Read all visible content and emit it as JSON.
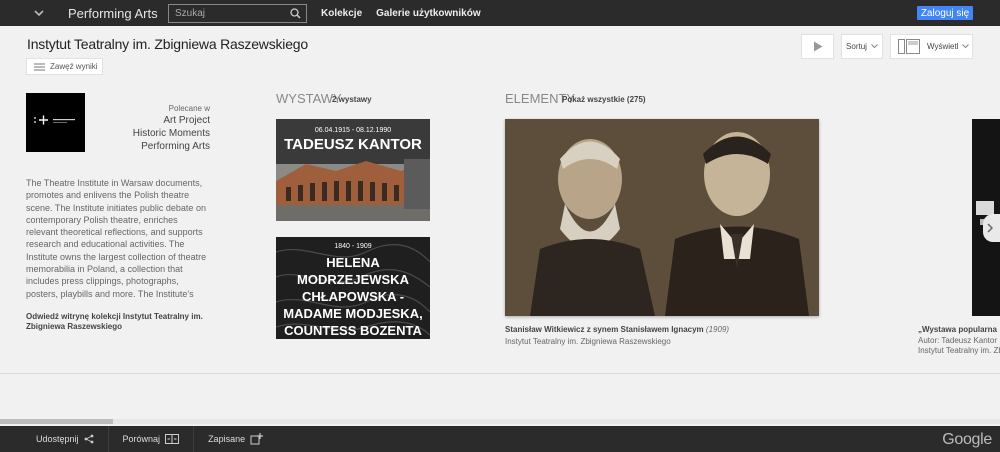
{
  "topbar": {
    "menu_icon": "chevron-down-icon",
    "brand": "Performing Arts",
    "search_placeholder": "Szukaj",
    "nav": [
      "Kolekcje",
      "Galerie użytkowników"
    ],
    "login_label": "Zaloguj się"
  },
  "header": {
    "title": "Instytut Teatralny im. Zbigniewa Raszewskiego",
    "refine_label": "Zawęź wyniki",
    "sort_label": "Sortuj",
    "view_label": "Wyświetl"
  },
  "sidebar": {
    "recommended_label": "Polecane w",
    "recommended_items": [
      "Art Project",
      "Historic Moments",
      "Performing Arts"
    ],
    "description": "The Theatre Institute in Warsaw documents, promotes and enlivens the Polish theatre scene. The Institute initiates public debate on contemporary Polish theatre, enriches relevant theoretical reflections, and supports research and educational activities. The Institute owns the largest collection of theatre memorabilia in Poland, a collection that includes press clippings, photographs, posters, playbills and more. The Institute's",
    "visit_link": "Odwiedź witrynę kolekcji Instytut Teatralny im. Zbigniewa Raszewskiego"
  },
  "exhibitions": {
    "heading": "WYSTAWY",
    "count": "2 wystawy",
    "items": [
      {
        "dates": "06.04.1915 - 08.12.1990",
        "title": "TADEUSZ KANTOR"
      },
      {
        "dates": "1840 - 1909",
        "title_lines": [
          "HELENA",
          "MODRZEJEWSKA",
          "CHŁAPOWSKA -",
          "MADAME MODJESKA,",
          "COUNTESS BOZENTA"
        ]
      }
    ]
  },
  "elements": {
    "heading": "ELEMENTY",
    "show_all": "Pokaż wszystkie (275)",
    "items": [
      {
        "title": "Stanisław Witkiewicz z synem Stanisławem Ignacym",
        "year": "(1909)",
        "author": "Instytut Teatralny im. Zbigniewa Raszewskiego"
      },
      {
        "title": "„Wystawa popularna",
        "author": "Autor: Tadeusz Kantor",
        "owner": "Instytut Teatralny im. Zbigniewa Raszewskiego"
      }
    ]
  },
  "footer": {
    "share_label": "Udostępnij",
    "compare_label": "Porównaj",
    "saved_label": "Zapisane",
    "logo": "Google"
  },
  "colors": {
    "topbar": "#2b2b2b",
    "accent": "#4285f4",
    "page_bg": "#f1f1f1"
  }
}
